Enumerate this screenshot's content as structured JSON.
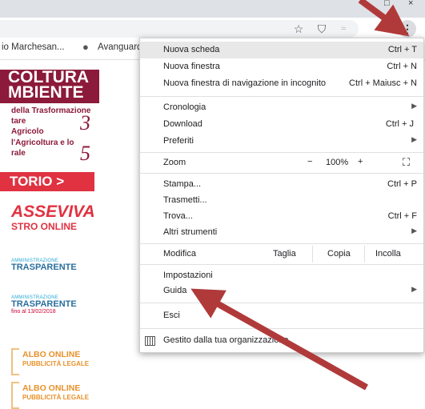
{
  "window": {
    "maximize": "□",
    "close": "×"
  },
  "toolbar": {
    "star_icon": "☆",
    "shield_icon": "⛉",
    "ext_icon": "≈",
    "profile_icon": "●",
    "menu_icon": "⋮"
  },
  "bookmarks": [
    {
      "label": "io Marchesan..."
    },
    {
      "label": "Avanguard"
    }
  ],
  "site": {
    "logo_line1": "COLTURA",
    "logo_line2": "MBIENTE",
    "line1": "della Trasformazione",
    "line2": "tare",
    "line3": "Agricolo",
    "line4": "l'Agricoltura e lo",
    "line5": "rale",
    "num1": "3",
    "num2": "5",
    "red_button": "TORIO >",
    "classeviva1": "ASSEVIVA",
    "classeviva2": "STRO ONLINE",
    "badge1_top": "AMMINISTRAZIONE",
    "badge1_main": "TRASPARENTE",
    "badge2_top": "AMMINISTRAZIONE",
    "badge2_main": "TRASPARENTE",
    "badge2_sub": "fino al 13/02/2018",
    "albo1_a": "ALBO ONLINE",
    "albo1_b": "PUBBLICITÀ LEGALE",
    "albo2_a": "ALBO ONLINE",
    "albo2_b": "PUBBLICITÀ LEGALE"
  },
  "menu": {
    "new_tab": {
      "label": "Nuova scheda",
      "shortcut": "Ctrl + T"
    },
    "new_window": {
      "label": "Nuova finestra",
      "shortcut": "Ctrl + N"
    },
    "incognito": {
      "label": "Nuova finestra di navigazione in incognito",
      "shortcut": "Ctrl + Maiusc + N"
    },
    "history": {
      "label": "Cronologia"
    },
    "downloads": {
      "label": "Download",
      "shortcut": "Ctrl + J"
    },
    "favorites": {
      "label": "Preferiti"
    },
    "zoom": {
      "label": "Zoom",
      "minus": "−",
      "value": "100%",
      "plus": "+",
      "fullscreen": "⛶"
    },
    "print": {
      "label": "Stampa...",
      "shortcut": "Ctrl + P"
    },
    "cast": {
      "label": "Trasmetti..."
    },
    "find": {
      "label": "Trova...",
      "shortcut": "Ctrl + F"
    },
    "tools": {
      "label": "Altri strumenti"
    },
    "edit": {
      "label": "Modifica",
      "cut": "Taglia",
      "copy": "Copia",
      "paste": "Incolla"
    },
    "settings": {
      "label": "Impostazioni"
    },
    "help": {
      "label": "Guida"
    },
    "exit": {
      "label": "Esci"
    },
    "managed": {
      "label": "Gestito dalla tua organizzazione"
    }
  },
  "colors": {
    "arrow": "#b03a3a",
    "accent": "#8c1a3a"
  }
}
